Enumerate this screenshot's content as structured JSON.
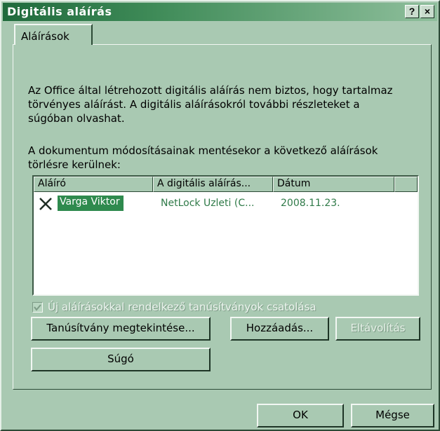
{
  "window": {
    "title": "Digitális aláírás",
    "help_button": "?",
    "close_button": "×"
  },
  "tab": {
    "label": "Aláírások"
  },
  "info": {
    "line1": "Az Office által létrehozott digitális aláírás nem biztos, hogy tartalmaz",
    "line2": "törvényes aláírást. A digitális aláírásokról további részleteket a",
    "line3": "súgóban olvashat."
  },
  "notice": {
    "line1": "A dokumentum módosításainak mentésekor a következő aláírások",
    "line2": "törlésre kerülnek:"
  },
  "table": {
    "columns": [
      "Aláíró",
      "A digitális aláírás...",
      "Dátum"
    ],
    "rows": [
      {
        "signer": "Varga Viktor",
        "issuer": "NetLock Uzleti (C...",
        "date": "2008.11.23."
      }
    ]
  },
  "checkbox": {
    "label": "Új aláírásokkal rendelkező tanúsítványok csatolása",
    "checked": true,
    "enabled": false
  },
  "buttons": {
    "view_certificate": "Tanúsítvány megtekintése...",
    "add": "Hozzáadás...",
    "remove": "Eltávolítás",
    "help": "Súgó",
    "ok": "OK",
    "cancel": "Mégse"
  }
}
